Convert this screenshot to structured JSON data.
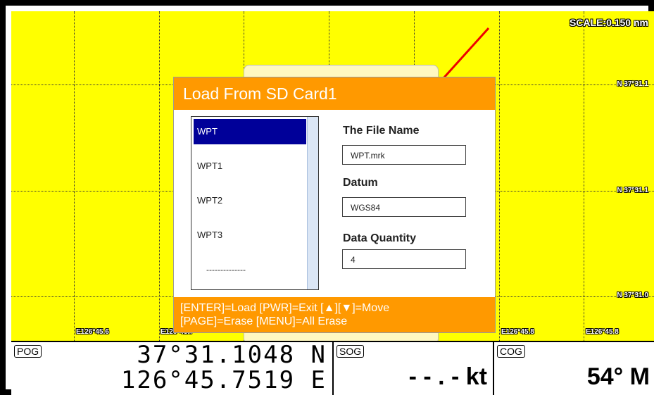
{
  "map": {
    "scale": "SCALE:0.150 nm",
    "lat_labels": [
      "N 37°31.1",
      "N 37°31.1",
      "N 37°31.0"
    ],
    "lon_labels": [
      "E126°45.6",
      "E126°45.7",
      "E126°45.8",
      "E126°45.8"
    ],
    "background_color": "#ffff00"
  },
  "dialog": {
    "title": "Load From SD Card1",
    "files": [
      "WPT",
      "WPT1",
      "WPT2",
      "WPT3"
    ],
    "files_more": "--------------",
    "selected_index": 0,
    "file_name_label": "The File Name",
    "file_name_value": "WPT.mrk",
    "datum_label": "Datum",
    "datum_value": "WGS84",
    "quantity_label": "Data Quantity",
    "quantity_value": "4",
    "footer_line1": "[ENTER]=Load [PWR]=Exit [▲][▼]=Move",
    "footer_line2": "[PAGE]=Erase [MENU]=All Erase",
    "accent_color": "#ff9900",
    "selection_color": "#000099"
  },
  "status": {
    "pog_tag": "POG",
    "pog_lat": "37°31.1048 N",
    "pog_lon": "126°45.7519 E",
    "sog_tag": "SOG",
    "sog_value": "- - . - kt",
    "cog_tag": "COG",
    "cog_value": "54° M"
  }
}
